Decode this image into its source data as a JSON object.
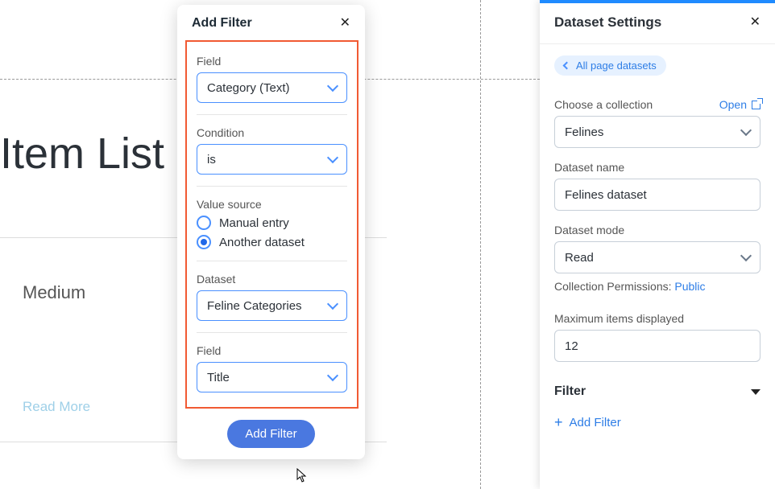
{
  "bg": {
    "title": "Item List",
    "card_text": "Medium",
    "read_more": "Read More"
  },
  "modal": {
    "title": "Add Filter",
    "field_label": "Field",
    "field_value": "Category (Text)",
    "condition_label": "Condition",
    "condition_value": "is",
    "value_source_label": "Value source",
    "radio_manual": "Manual entry",
    "radio_another": "Another dataset",
    "dataset_label": "Dataset",
    "dataset_value": "Feline Categories",
    "field2_label": "Field",
    "field2_value": "Title",
    "submit": "Add Filter"
  },
  "panel": {
    "title": "Dataset Settings",
    "back_pill": "All page datasets",
    "choose_collection_label": "Choose a collection",
    "open_link": "Open",
    "collection_value": "Felines",
    "dataset_name_label": "Dataset name",
    "dataset_name_value": "Felines dataset",
    "dataset_mode_label": "Dataset mode",
    "dataset_mode_value": "Read",
    "permissions_label": "Collection Permissions:",
    "permissions_value": "Public",
    "max_items_label": "Maximum items displayed",
    "max_items_value": "12",
    "filter_header": "Filter",
    "add_filter": "Add Filter"
  }
}
